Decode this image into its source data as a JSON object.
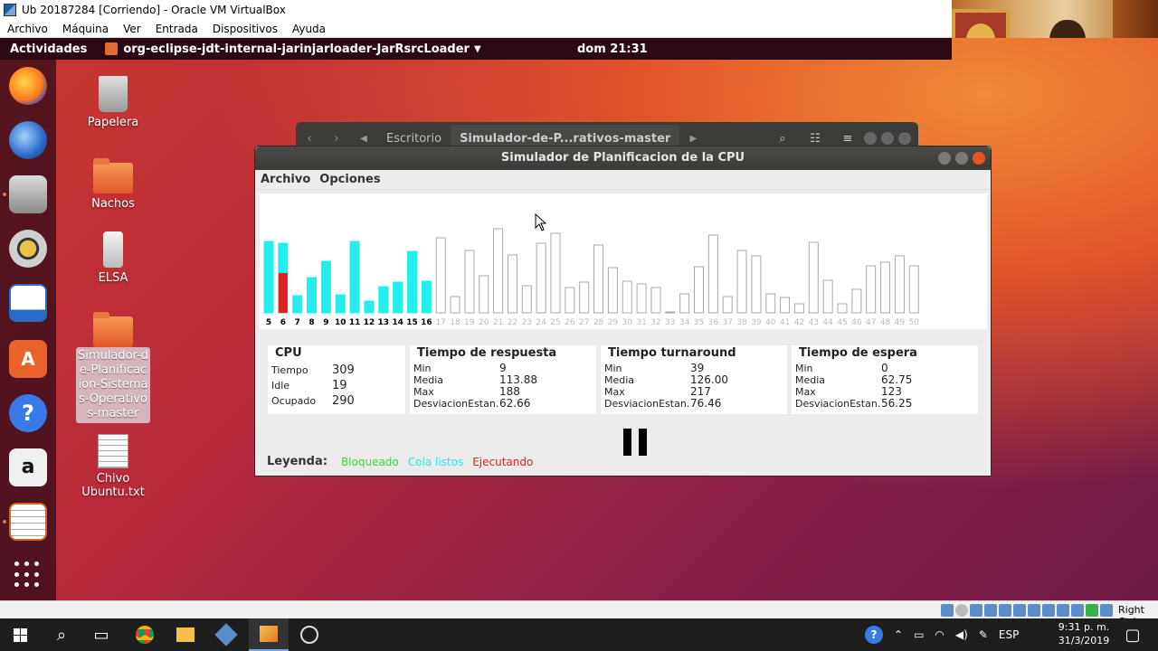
{
  "vbox": {
    "title": "Ub 20187284 [Corriendo] - Oracle VM VirtualBox",
    "menu": [
      "Archivo",
      "Máquina",
      "Ver",
      "Entrada",
      "Dispositivos",
      "Ayuda"
    ],
    "host_key": "Right Ctrl"
  },
  "ubuntu": {
    "activities": "Actividades",
    "app_name": "org-eclipse-jdt-internal-jarinjarloader-JarRsrcLoader",
    "clock": "dom 21:31"
  },
  "desktop_icons": [
    {
      "label": "Papelera"
    },
    {
      "label": "Nachos"
    },
    {
      "label": "ELSA"
    },
    {
      "label": "Simulador-de-Planificacion-Sistemas-Operativos-master"
    },
    {
      "label": "Chivo Ubuntu.txt"
    }
  ],
  "files_window": {
    "crumb1": "Escritorio",
    "crumb2": "Simulador-de-P...rativos-master"
  },
  "simulator": {
    "title": "Simulador de Planificacion de la CPU",
    "menu": [
      "Archivo",
      "Opciones"
    ],
    "cpu": {
      "title": "CPU",
      "rows": [
        {
          "k": "Tiempo",
          "v": "309"
        },
        {
          "k": "Idle",
          "v": "19"
        },
        {
          "k": "Ocupado",
          "v": "290"
        }
      ]
    },
    "respuesta": {
      "title": "Tiempo de respuesta",
      "rows": [
        {
          "k": "Min",
          "v": "9"
        },
        {
          "k": "Media",
          "v": "113.88"
        },
        {
          "k": "Max",
          "v": "188"
        },
        {
          "k": "DesviacionEstan...",
          "v": "62.66"
        }
      ]
    },
    "turnaround": {
      "title": "Tiempo turnaround",
      "rows": [
        {
          "k": "Min",
          "v": "39"
        },
        {
          "k": "Media",
          "v": "126.00"
        },
        {
          "k": "Max",
          "v": "217"
        },
        {
          "k": "DesviacionEstan...",
          "v": "76.46"
        }
      ]
    },
    "espera": {
      "title": "Tiempo de espera",
      "rows": [
        {
          "k": "Min",
          "v": "0"
        },
        {
          "k": "Media",
          "v": "62.75"
        },
        {
          "k": "Max",
          "v": "123"
        },
        {
          "k": "DesviacionEstan...",
          "v": "56.25"
        }
      ]
    },
    "legend": {
      "label": "Leyenda:",
      "bloqueado": "Bloqueado",
      "listos": "Cola listos",
      "ejecutando": "Ejecutando",
      "colors": {
        "bloqueado": "#33dd33",
        "listos": "#22eeee",
        "ejecutando": "#dd2222"
      }
    }
  },
  "chart_data": {
    "type": "bar",
    "categories": [
      "5",
      "6",
      "7",
      "8",
      "9",
      "10",
      "11",
      "12",
      "13",
      "14",
      "15",
      "16",
      "17",
      "18",
      "19",
      "20",
      "21",
      "22",
      "23",
      "24",
      "25",
      "26",
      "27",
      "28",
      "29",
      "30",
      "31",
      "32",
      "33",
      "34",
      "35",
      "36",
      "37",
      "38",
      "39",
      "40",
      "41",
      "42",
      "43",
      "44",
      "45",
      "46",
      "47",
      "48",
      "49",
      "50"
    ],
    "values": [
      79,
      77,
      19,
      39,
      57,
      20,
      79,
      13,
      29,
      34,
      68,
      35,
      83,
      18,
      69,
      41,
      93,
      64,
      30,
      77,
      88,
      28,
      34,
      75,
      50,
      35,
      32,
      28,
      1,
      21,
      51,
      86,
      18,
      69,
      63,
      21,
      17,
      10,
      78,
      36,
      10,
      26,
      52,
      56,
      63,
      52
    ],
    "fills": [
      "listo",
      "listo",
      "listo",
      "listo",
      "listo",
      "listo",
      "listo",
      "listo",
      "listo",
      "listo",
      "listo",
      "listo",
      "none",
      "none",
      "none",
      "none",
      "none",
      "none",
      "none",
      "none",
      "none",
      "none",
      "none",
      "none",
      "none",
      "none",
      "none",
      "none",
      "none",
      "none",
      "none",
      "none",
      "none",
      "none",
      "none",
      "none",
      "none",
      "none",
      "none",
      "none",
      "none",
      "none",
      "none",
      "none",
      "none",
      "none"
    ],
    "partial": {
      "index": 1,
      "filled": 44,
      "state": "ejecutando"
    },
    "ylim": [
      0,
      100
    ],
    "xlabel": "",
    "ylabel": "",
    "title": ""
  },
  "taskbar": {
    "lang": "ESP",
    "time": "9:31 p. m.",
    "date": "31/3/2019"
  }
}
